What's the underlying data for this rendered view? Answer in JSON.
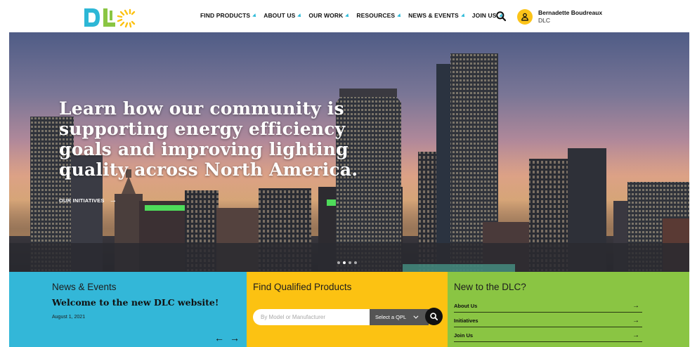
{
  "brand": {
    "logo_text": "DLC"
  },
  "nav": {
    "items": [
      {
        "label": "FIND PRODUCTS"
      },
      {
        "label": "ABOUT US"
      },
      {
        "label": "OUR WORK"
      },
      {
        "label": "RESOURCES"
      },
      {
        "label": "NEWS & EVENTS"
      },
      {
        "label": "JOIN US"
      }
    ]
  },
  "user": {
    "name": "Bernadette Boudreaux",
    "org": "DLC"
  },
  "hero": {
    "title": "Learn how our community is supporting energy efficiency goals and improving lighting quality across North America.",
    "cta_label": "OUR INITIATIVES",
    "cta_arrow": "→",
    "slide_count": 4,
    "active_slide": 2
  },
  "news": {
    "heading": "News & Events",
    "headline": "Welcome to the new DLC website!",
    "date": "August 1, 2021",
    "prev": "←",
    "next": "→"
  },
  "find": {
    "heading": "Find Qualified Products",
    "placeholder": "By Model or Manufacturer",
    "select_label": "Select a QPL"
  },
  "newto": {
    "heading": "New to the DLC?",
    "links": [
      {
        "label": "About Us",
        "arrow": "→"
      },
      {
        "label": "Initiatives",
        "arrow": "→"
      },
      {
        "label": "Join Us",
        "arrow": "→"
      }
    ]
  },
  "colors": {
    "news_panel": "#33b7d8",
    "find_panel": "#fcc212",
    "new_panel": "#8ac543",
    "nav_caret": "#2dbad8",
    "avatar": "#fcc419"
  }
}
